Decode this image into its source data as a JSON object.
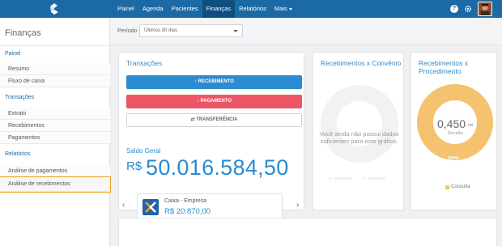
{
  "nav": {
    "items": [
      {
        "label": "Painel",
        "active": false
      },
      {
        "label": "Agenda",
        "active": false
      },
      {
        "label": "Pacientes",
        "active": false
      },
      {
        "label": "Finanças",
        "active": true
      },
      {
        "label": "Relatórios",
        "active": false
      },
      {
        "label": "Mais",
        "active": false,
        "dropdown": true
      }
    ],
    "help_glyph": "?",
    "icons": [
      "logo-icon",
      "help-icon",
      "gear-icon",
      "avatar"
    ]
  },
  "sidebar": {
    "title": "Finanças",
    "sections": [
      {
        "label": "Painel",
        "items": [
          "Resumo",
          "Fluxo de caixa"
        ]
      },
      {
        "label": "Transações",
        "items": [
          "Extrato",
          "Recebimentos",
          "Pagamentos"
        ]
      },
      {
        "label": "Relatórios",
        "items": [
          "Análise de pagamentos",
          "Análise de recebimentos"
        ]
      }
    ],
    "highlighted_item": "Análise de recebimentos"
  },
  "filter": {
    "label": "Período",
    "selected": "Últimos 30 dias"
  },
  "transacoes": {
    "title": "Transações",
    "buttons": {
      "recebimento": "↑ RECEBIMENTO",
      "pagamento": "↓ PAGAMENTO",
      "transferencia": "⇄ TRANSFERÊNCIA"
    },
    "saldo_label": "Saldo Geral",
    "saldo_currency": "R$",
    "saldo_value": "50.016.584,50",
    "account": {
      "name": "Caixa - Empresa",
      "amount": "R$ 20.870,00"
    },
    "carousel": {
      "count": 7,
      "active_index": 0
    }
  },
  "convenio": {
    "title": "Recebimentos x Convênio",
    "empty_message": "Você ainda não possui dados suficientes para este gráfico."
  },
  "procedimento": {
    "title": "Recebimentos x Procedimento",
    "center_value": "0,450",
    "center_unit": "mil",
    "center_sub": "Receita",
    "slice_label": "100%",
    "legend": [
      {
        "label": "Consulta",
        "color": "#f5c270"
      }
    ]
  },
  "colors": {
    "brand_blue": "#1b6aa5",
    "accent_blue": "#2a8bd0",
    "danger": "#eb5566",
    "donut": "#f5c270",
    "highlight_outline": "#f0a020"
  }
}
